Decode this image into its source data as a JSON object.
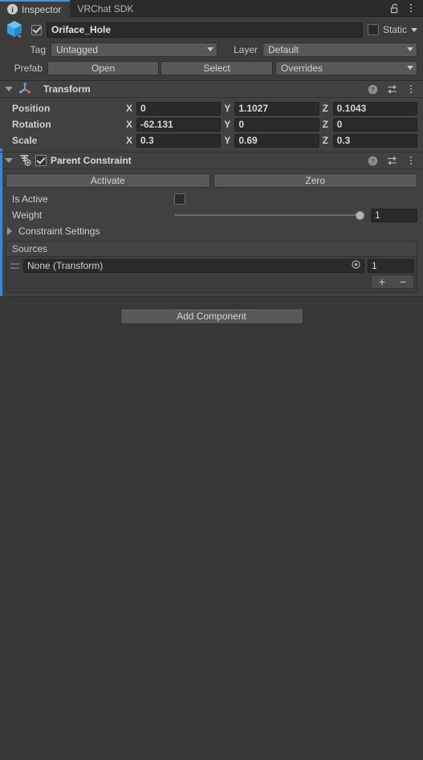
{
  "window": {
    "tabs": [
      {
        "label": "Inspector",
        "icon": "info-icon",
        "active": true
      },
      {
        "label": "VRChat SDK",
        "icon": null,
        "active": false
      }
    ],
    "lock_icon": "padlock-unlocked-icon",
    "menu_icon": "kebab-menu-icon"
  },
  "object_header": {
    "icon": "prefab-cube-icon",
    "enabled": true,
    "name": "Oriface_Hole",
    "name_placeholder": "Name",
    "static_checked": false,
    "static_label": "Static",
    "tag_label": "Tag",
    "tag_value": "Untagged",
    "layer_label": "Layer",
    "layer_value": "Default",
    "prefab_label": "Prefab",
    "prefab_open": "Open",
    "prefab_select": "Select",
    "prefab_overrides": "Overrides"
  },
  "transform": {
    "title": "Transform",
    "icon": "transform-axis-icon",
    "expanded": true,
    "help_icon": "help-icon",
    "preset_icon": "preset-settings-icon",
    "menu_icon": "kebab-menu-icon",
    "rows": [
      {
        "label": "Position",
        "x": "0",
        "y": "1.1027",
        "z": "0.1043"
      },
      {
        "label": "Rotation",
        "x": "-62.131",
        "y": "0",
        "z": "0"
      },
      {
        "label": "Scale",
        "x": "0.3",
        "y": "0.69",
        "z": "0.3"
      }
    ],
    "axis_labels": [
      "X",
      "Y",
      "Z"
    ]
  },
  "parent_constraint": {
    "title": "Parent Constraint",
    "icon": "parent-constraint-icon",
    "expanded": true,
    "enabled": true,
    "help_icon": "help-icon",
    "preset_icon": "preset-settings-icon",
    "menu_icon": "kebab-menu-icon",
    "activate_label": "Activate",
    "zero_label": "Zero",
    "is_active_label": "Is Active",
    "is_active_checked": false,
    "weight_label": "Weight",
    "weight_value": "1",
    "weight_percent": 100,
    "constraint_settings_label": "Constraint Settings",
    "constraint_settings_expanded": false,
    "sources_label": "Sources",
    "sources": [
      {
        "object": "None (Transform)",
        "weight": "1",
        "picker_icon": "object-picker-icon",
        "grip_icon": "drag-handle-icon"
      }
    ],
    "add_source_label": "+",
    "remove_source_label": "−"
  },
  "footer": {
    "add_component_label": "Add Component"
  },
  "colors": {
    "accent_blue": "#4a90d9",
    "override_blue": "#3a86d6",
    "panel_bg": "#383838",
    "component_bg": "#414141",
    "field_bg": "#2a2a2a"
  }
}
